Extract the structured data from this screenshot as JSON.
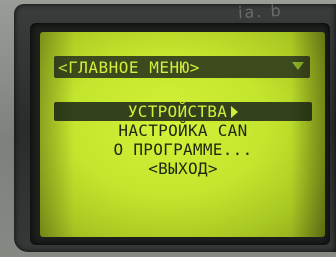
{
  "device": {
    "edge_text": "ia. b"
  },
  "screen": {
    "title": "<ГЛАВНОЕ МЕНЮ>"
  },
  "menu": {
    "items": [
      {
        "label": "УСТРОЙСТВА",
        "selected": true
      },
      {
        "label": "НАСТРОЙКА CAN",
        "selected": false
      },
      {
        "label": "О ПРОГРАММЕ...",
        "selected": false
      },
      {
        "label": "<ВЫХОД>",
        "selected": false
      }
    ]
  },
  "icons": {
    "scroll": "scroll-down-arrow-icon",
    "submenu": "submenu-arrow-icon"
  },
  "colors": {
    "lcd_background": "#c4e52d",
    "lcd_text_dark": "#1f2812",
    "lcd_highlight": "#33421a"
  }
}
